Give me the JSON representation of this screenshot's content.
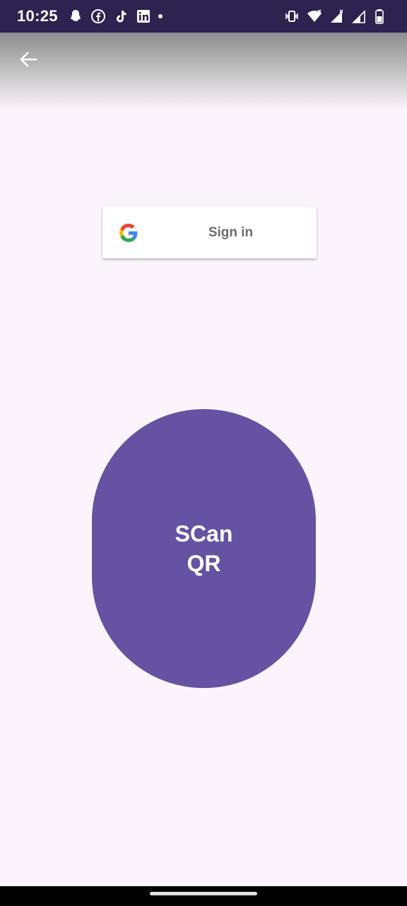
{
  "status_bar": {
    "time": "10:25",
    "left_icons": [
      "snapchat-icon",
      "facebook-icon",
      "tiktok-icon",
      "linkedin-icon",
      "notification-dot-icon"
    ],
    "right_icons": [
      "vibrate-icon",
      "wifi-icon",
      "signal-icon",
      "signal-icon-2",
      "battery-icon"
    ]
  },
  "header": {
    "back_icon": "arrow-left-icon"
  },
  "google_signin": {
    "label": "Sign in",
    "icon": "google-icon"
  },
  "scan_button": {
    "label": "SCan QR"
  },
  "colors": {
    "status_bar": "#2d2350",
    "background": "#fcf4fc",
    "scan_button": "#6552a3",
    "signin_text": "#6c6c6c"
  }
}
